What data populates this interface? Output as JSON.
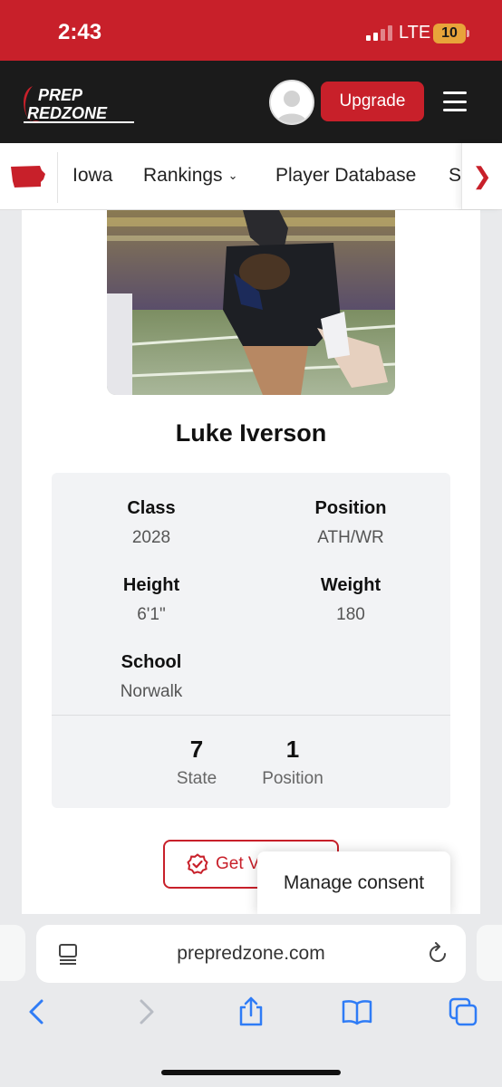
{
  "status_bar": {
    "time": "2:43",
    "network": "LTE",
    "battery": "10"
  },
  "header": {
    "logo_top": "PREP",
    "logo_bottom": "REDZONE",
    "upgrade_label": "Upgrade"
  },
  "nav": {
    "items": [
      {
        "label": "Iowa"
      },
      {
        "label": "Rankings"
      },
      {
        "label": "Player Database"
      },
      {
        "label": "S"
      }
    ]
  },
  "player": {
    "name": "Luke Iverson",
    "fields": {
      "class_label": "Class",
      "class_value": "2028",
      "position_label": "Position",
      "position_value": "ATH/WR",
      "height_label": "Height",
      "height_value": "6'1\"",
      "weight_label": "Weight",
      "weight_value": "180",
      "school_label": "School",
      "school_value": "Norwalk"
    },
    "rankings": {
      "state_value": "7",
      "state_label": "State",
      "position_value": "1",
      "position_label": "Position"
    }
  },
  "actions": {
    "get_button_label": "Get V"
  },
  "consent": {
    "label": "Manage consent"
  },
  "browser": {
    "url": "prepredzone.com"
  },
  "colors": {
    "brand_red": "#c8202a",
    "header_dark": "#1b1b1b",
    "ios_blue": "#2f7cf6"
  }
}
